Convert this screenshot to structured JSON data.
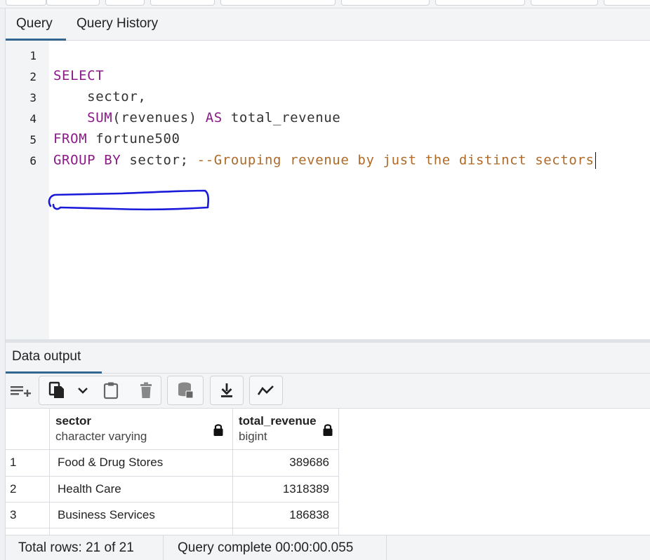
{
  "tabs": {
    "query": "Query",
    "history": "Query History"
  },
  "editor": {
    "line_numbers": [
      "1",
      "2",
      "3",
      "4",
      "5",
      "6"
    ],
    "lines": [
      {
        "indent": "",
        "kw1": "",
        "text1": "",
        "kw2": "",
        "text2": "",
        "comment": ""
      },
      {
        "indent": "",
        "kw1": "SELECT",
        "text1": "",
        "kw2": "",
        "text2": "",
        "comment": ""
      },
      {
        "indent": "    ",
        "kw1": "",
        "text1": "sector,",
        "kw2": "",
        "text2": "",
        "comment": ""
      },
      {
        "indent": "    ",
        "kw1": "SUM",
        "text1": "(revenues) ",
        "kw2": "AS",
        "text2": " total_revenue",
        "comment": ""
      },
      {
        "indent": "",
        "kw1": "FROM",
        "text1": " fortune500",
        "kw2": "",
        "text2": "",
        "comment": ""
      },
      {
        "indent": "",
        "kw1": "GROUP BY",
        "text1": " sector; ",
        "kw2": "",
        "text2": "",
        "comment": "--Grouping revenue by just the distinct sectors"
      }
    ],
    "annotation_color": "#1a1adb"
  },
  "output": {
    "tab_label": "Data output",
    "toolbar_icons": [
      "add-row-icon",
      "copy-icon",
      "chevron-down-icon",
      "paste-icon",
      "delete-icon",
      "save-data-icon",
      "download-icon",
      "graph-icon"
    ],
    "columns": [
      {
        "name": "sector",
        "type": "character varying"
      },
      {
        "name": "total_revenue",
        "type": "bigint"
      }
    ],
    "rows": [
      {
        "num": "1",
        "sector": "Food & Drug Stores",
        "total_revenue": "389686"
      },
      {
        "num": "2",
        "sector": "Health Care",
        "total_revenue": "1318389"
      },
      {
        "num": "3",
        "sector": "Business Services",
        "total_revenue": "186838"
      }
    ]
  },
  "status": {
    "rows": "Total rows: 21 of 21",
    "time": "Query complete 00:00:00.055"
  },
  "colors": {
    "accent": "#326690",
    "keyword": "#8a1a87",
    "comment": "#b06a27"
  }
}
